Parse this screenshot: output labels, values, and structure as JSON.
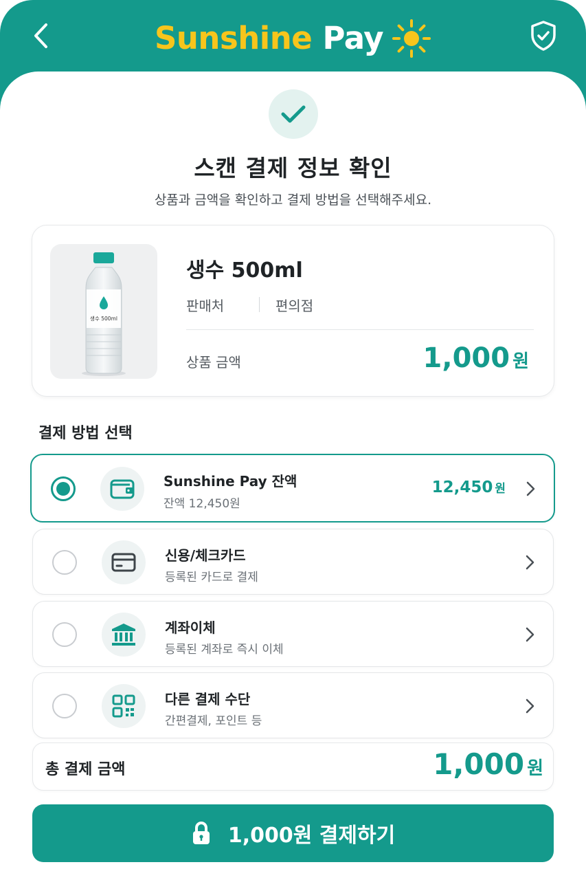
{
  "header": {
    "brand_part1": "Sunshine",
    "brand_part2": "Pay",
    "icons": {
      "back": "chevron-left-icon",
      "brand": "sun-icon",
      "security": "shield-check-icon"
    }
  },
  "confirm": {
    "icon": "check-icon",
    "title": "스캔 결제 정보 확인",
    "subtitle": "상품과 금액을 확인하고 결제 방법을 선택해주세요."
  },
  "product": {
    "bottle_label": "생수 500ml",
    "name": "생수 500ml",
    "seller_label": "판매처",
    "seller_value": "편의점",
    "price_label": "상품 금액",
    "price": "1,000",
    "price_unit": "원"
  },
  "payment": {
    "section_title": "결제 방법 선택",
    "selected_index": 0,
    "methods": [
      {
        "title": "Sunshine Pay 잔액",
        "sub": "잔액 12,450원",
        "amount": "12,450",
        "amount_unit": "원",
        "icon": "wallet-icon"
      },
      {
        "title": "신용/체크카드",
        "sub": "등록된 카드로 결제",
        "icon": "credit-card-icon"
      },
      {
        "title": "계좌이체",
        "sub": "등록된 계좌로 즉시 이체",
        "icon": "bank-icon"
      },
      {
        "title": "다른 결제 수단",
        "sub": "간편결제, 포인트 등",
        "icon": "qr-code-icon"
      }
    ]
  },
  "total": {
    "label": "총 결제 금액",
    "amount": "1,000",
    "unit": "원"
  },
  "pay_button": {
    "label": "1,000원 결제하기",
    "icon": "lock-icon"
  },
  "colors": {
    "primary": "#149a8c",
    "brand_yellow": "#f7c51c",
    "text": "#1f2326"
  }
}
